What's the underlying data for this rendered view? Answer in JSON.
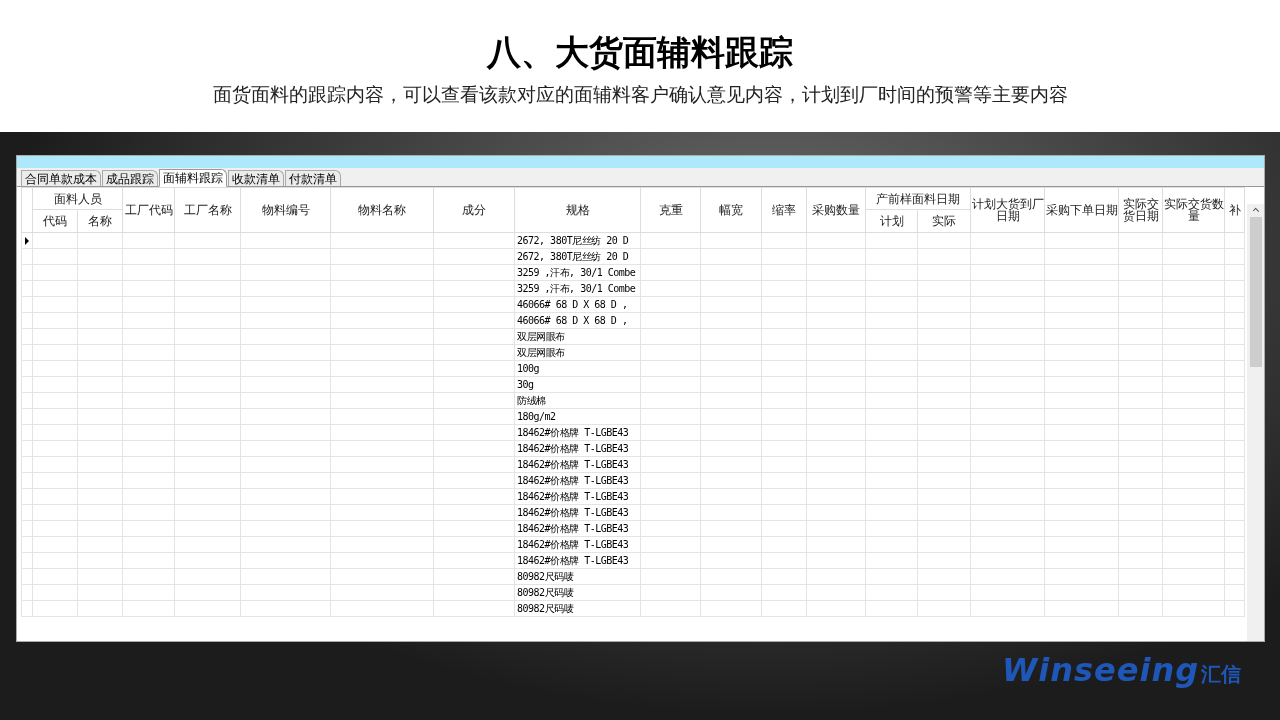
{
  "slide": {
    "title": "八、大货面辅料跟踪",
    "subtitle": "面货面料的跟踪内容，可以查看该款对应的面辅料客户确认意见内容，计划到厂时间的预警等主要内容"
  },
  "tabs": [
    {
      "label": "合同单款成本",
      "selected": false
    },
    {
      "label": "成品跟踪",
      "selected": false
    },
    {
      "label": "面辅料跟踪",
      "selected": true
    },
    {
      "label": "收款清单",
      "selected": false
    },
    {
      "label": "付款清单",
      "selected": false
    }
  ],
  "table": {
    "columns": [
      {
        "label": "面料人员",
        "children": [
          "代码",
          "名称"
        ]
      },
      {
        "label": "工厂代码"
      },
      {
        "label": "工厂名称"
      },
      {
        "label": "物料编号"
      },
      {
        "label": "物料名称"
      },
      {
        "label": "成分"
      },
      {
        "label": "规格"
      },
      {
        "label": "克重"
      },
      {
        "label": "幅宽"
      },
      {
        "label": "缩率"
      },
      {
        "label": "采购数量"
      },
      {
        "label": "产前样面料日期",
        "children": [
          "计划",
          "实际"
        ]
      },
      {
        "label": "计划大货到厂日期"
      },
      {
        "label": "采购下单日期"
      },
      {
        "label": "实际交货日期"
      },
      {
        "label": "实际交货数量"
      },
      {
        "label": "补"
      }
    ],
    "rows": [
      {
        "spec": "2672, 380T尼丝纺 20 D",
        "current": true
      },
      {
        "spec": "2672, 380T尼丝纺 20 D",
        "current": false
      },
      {
        "spec": "3259 ,汗布, 30/1 Combe",
        "current": false
      },
      {
        "spec": "3259 ,汗布, 30/1 Combe",
        "current": false
      },
      {
        "spec": "46066#  68 D X 68 D ,",
        "current": false
      },
      {
        "spec": "46066#  68 D X 68 D ,",
        "current": false
      },
      {
        "spec": "双层网眼布",
        "current": false
      },
      {
        "spec": "双层网眼布",
        "current": false
      },
      {
        "spec": "100g",
        "current": false
      },
      {
        "spec": "30g",
        "current": false
      },
      {
        "spec": "防绒棉",
        "current": false
      },
      {
        "spec": "180g/m2",
        "current": false
      },
      {
        "spec": "18462#价格牌 T-LGBE43",
        "current": false
      },
      {
        "spec": "18462#价格牌 T-LGBE43",
        "current": false
      },
      {
        "spec": "18462#价格牌 T-LGBE43",
        "current": false
      },
      {
        "spec": "18462#价格牌 T-LGBE43",
        "current": false
      },
      {
        "spec": "18462#价格牌 T-LGBE43",
        "current": false
      },
      {
        "spec": "18462#价格牌 T-LGBE43",
        "current": false
      },
      {
        "spec": "18462#价格牌 T-LGBE43",
        "current": false
      },
      {
        "spec": "18462#价格牌 T-LGBE43",
        "current": false
      },
      {
        "spec": "18462#价格牌 T-LGBE43",
        "current": false
      },
      {
        "spec": "80982尺码唛",
        "current": false
      },
      {
        "spec": "80982尺码唛",
        "current": false
      },
      {
        "spec": "80982尺码唛",
        "current": false
      }
    ]
  },
  "logo": {
    "name": "Winseeing",
    "chinese": "汇信"
  }
}
